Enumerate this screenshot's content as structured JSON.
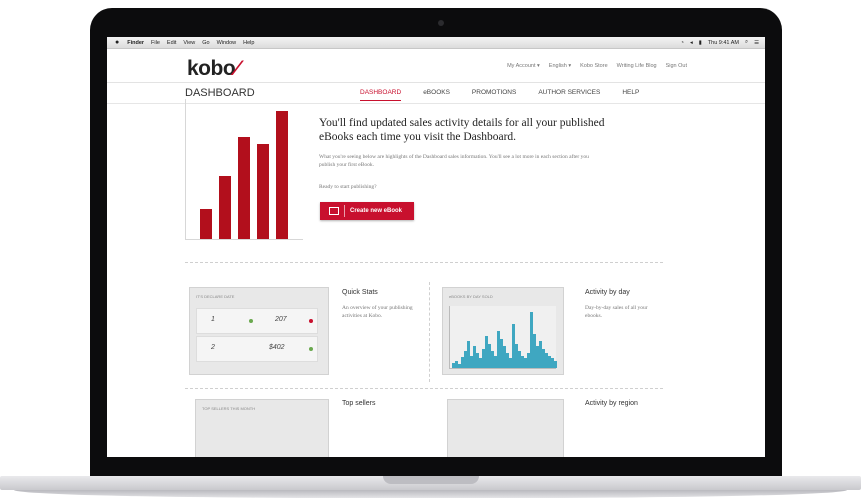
{
  "menubar": {
    "apple": "",
    "items": [
      "Finder",
      "File",
      "Edit",
      "View",
      "Go",
      "Window",
      "Help"
    ],
    "clock": "Thu 9:41 AM"
  },
  "header": {
    "logo": "kobo",
    "toplinks": [
      "My Account ▾",
      "English ▾",
      "Kobo Store",
      "Writing Life Blog",
      "Sign Out"
    ]
  },
  "nav": {
    "items": [
      "DASHBOARD",
      "eBOOKS",
      "PROMOTIONS",
      "AUTHOR SERVICES",
      "HELP"
    ],
    "active": "DASHBOARD"
  },
  "dashboard": {
    "title": "DASHBOARD",
    "hero_title": "You'll find updated sales activity details for all your published eBooks each time you visit the Dashboard.",
    "hero_text": "What you're seeing below are highlights of the Dashboard sales information. You'll see a lot more in each section after you publish your first eBook.",
    "ready": "Ready to start publishing?",
    "create_button": "Create new eBook"
  },
  "promo_chart": {
    "type": "bar",
    "values": [
      30,
      62,
      100,
      94,
      126
    ],
    "ymax": 126,
    "bar_color": "#b20f1c"
  },
  "cards": {
    "quick_stats": {
      "title": "Quick Stats",
      "text": "An overview of your publishing activities at Kobo.",
      "thumb_head": "IT'S DECLARE DATE",
      "row1_num_a": "1",
      "row1_num_b": "207",
      "row2_num_a": "2",
      "row2_num_b": "$402"
    },
    "activity_day": {
      "title": "Activity by day",
      "text": "Day-by-day sales of all your ebooks.",
      "thumb_head": "eBOOKS BY DAY SOLD",
      "bar_color": "#3fa7c1",
      "values": [
        4,
        6,
        3,
        9,
        14,
        22,
        10,
        18,
        12,
        8,
        16,
        26,
        20,
        14,
        10,
        30,
        24,
        18,
        12,
        8,
        36,
        20,
        14,
        10,
        8,
        12,
        46,
        28,
        18,
        22,
        16,
        12,
        10,
        8,
        6
      ]
    },
    "top_sellers": {
      "title": "Top sellers",
      "thumb_head": "TOP SELLERS THIS MONTH"
    },
    "activity_region": {
      "title": "Activity by region"
    }
  }
}
